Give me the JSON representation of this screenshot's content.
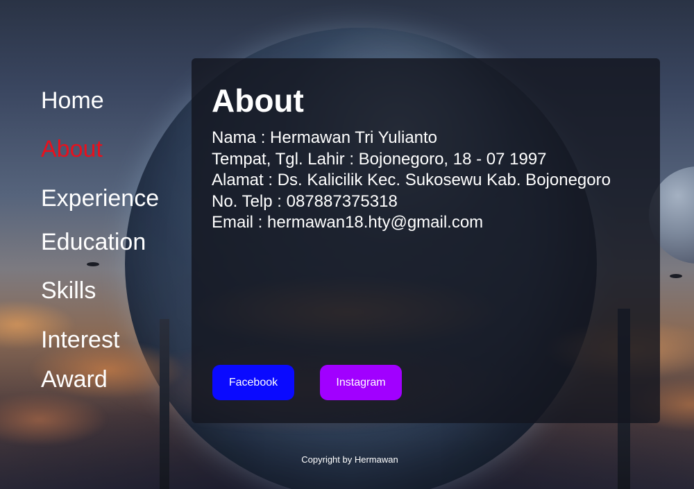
{
  "nav": {
    "items": [
      {
        "label": "Home",
        "active": false
      },
      {
        "label": "About",
        "active": true
      },
      {
        "label": "Experience",
        "active": false
      },
      {
        "label": "Education",
        "active": false
      },
      {
        "label": "Skills",
        "active": false
      },
      {
        "label": "Interest",
        "active": false
      },
      {
        "label": "Award",
        "active": false
      }
    ],
    "active_color": "#e8101c"
  },
  "about": {
    "title": "About",
    "lines": [
      "Nama : Hermawan Tri Yulianto",
      "Tempat, Tgl. Lahir : Bojonegoro, 18 - 07 1997",
      "Alamat : Ds. Kalicilik Kec. Sukosewu Kab. Bojonegoro",
      "No. Telp : 087887375318",
      "Email : hermawan18.hty@gmail.com"
    ]
  },
  "social": {
    "facebook_label": "Facebook",
    "facebook_color": "#0a0aff",
    "instagram_label": "Instagram",
    "instagram_color": "#a100ff"
  },
  "footer": {
    "copyright": "Copyright by Hermawan"
  }
}
